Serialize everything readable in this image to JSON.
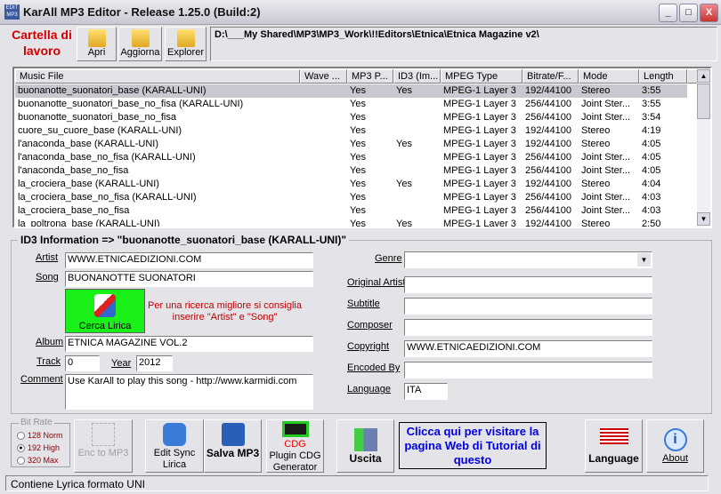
{
  "window": {
    "title": "KarAll MP3 Editor - Release 1.25.0 (Build:2)",
    "app_icon_text": "EDIT MP3"
  },
  "toolbar": {
    "folder_label": "Cartella di lavoro",
    "buttons": [
      {
        "label": "Apri",
        "icon": "folder-music-icon"
      },
      {
        "label": "Aggiorna",
        "icon": "folder-refresh-icon"
      },
      {
        "label": "Explorer",
        "icon": "folder-window-icon"
      }
    ],
    "path": "D:\\___My Shared\\MP3\\MP3_Work\\!!Editors\\Etnica\\Etnica Magazine v2\\"
  },
  "list": {
    "columns": [
      "Music File",
      "Wave ...",
      "MP3 P...",
      "ID3 (Im...",
      "MPEG Type",
      "Bitrate/F...",
      "Mode",
      "Length"
    ],
    "rows": [
      [
        "buonanotte_suonatori_base (KARALL-UNI)",
        "",
        "Yes",
        "Yes",
        "MPEG-1 Layer 3",
        "192/44100",
        "Stereo",
        "3:55"
      ],
      [
        "buonanotte_suonatori_base_no_fisa (KARALL-UNI)",
        "",
        "Yes",
        "",
        "MPEG-1 Layer 3",
        "256/44100",
        "Joint Ster...",
        "3:55"
      ],
      [
        "buonanotte_suonatori_base_no_fisa",
        "",
        "Yes",
        "",
        "MPEG-1 Layer 3",
        "256/44100",
        "Joint Ster...",
        "3:54"
      ],
      [
        "cuore_su_cuore_base (KARALL-UNI)",
        "",
        "Yes",
        "",
        "MPEG-1 Layer 3",
        "192/44100",
        "Stereo",
        "4:19"
      ],
      [
        "l'anaconda_base (KARALL-UNI)",
        "",
        "Yes",
        "Yes",
        "MPEG-1 Layer 3",
        "192/44100",
        "Stereo",
        "4:05"
      ],
      [
        "l'anaconda_base_no_fisa (KARALL-UNI)",
        "",
        "Yes",
        "",
        "MPEG-1 Layer 3",
        "256/44100",
        "Joint Ster...",
        "4:05"
      ],
      [
        "l'anaconda_base_no_fisa",
        "",
        "Yes",
        "",
        "MPEG-1 Layer 3",
        "256/44100",
        "Joint Ster...",
        "4:05"
      ],
      [
        "la_crociera_base (KARALL-UNI)",
        "",
        "Yes",
        "Yes",
        "MPEG-1 Layer 3",
        "192/44100",
        "Stereo",
        "4:04"
      ],
      [
        "la_crociera_base_no_fisa (KARALL-UNI)",
        "",
        "Yes",
        "",
        "MPEG-1 Layer 3",
        "256/44100",
        "Joint Ster...",
        "4:03"
      ],
      [
        "la_crociera_base_no_fisa",
        "",
        "Yes",
        "",
        "MPEG-1 Layer 3",
        "256/44100",
        "Joint Ster...",
        "4:03"
      ],
      [
        "la_poltrona_base (KARALL-UNI)",
        "",
        "Yes",
        "Yes",
        "MPEG-1 Layer 3",
        "192/44100",
        "Stereo",
        "2:50"
      ]
    ],
    "selected_row": 0
  },
  "id3": {
    "title": "ID3 Information => \"buonanotte_suonatori_base (KARALL-UNI)\"",
    "artist_label": "Artist",
    "artist": "WWW.ETNICAEDIZIONI.COM",
    "song_label": "Song",
    "song": "BUONANOTTE SUONATORI",
    "cerca_label": "Cerca Lirica",
    "hint": "Per una ricerca migliore si consiglia inserire \"Artist\" e \"Song\"",
    "album_label": "Album",
    "album": "ETNICA MAGAZINE VOL.2",
    "track_label": "Track",
    "track": "0",
    "year_label": "Year",
    "year": "2012",
    "comment_label": "Comment",
    "comment": "Use KarAll to play this song - http://www.karmidi.com",
    "genre_label": "Genre",
    "genre": "",
    "original_artist_label": "Original Artist",
    "original_artist": "",
    "subtitle_label": "Subtitle",
    "subtitle": "",
    "composer_label": "Composer",
    "composer": "",
    "copyright_label": "Copyright",
    "copyright": "WWW.ETNICAEDIZIONI.COM",
    "encoded_by_label": "Encoded By",
    "encoded_by": "",
    "language_label": "Language",
    "language": "ITA"
  },
  "bottom": {
    "bitrate_label": "Bit Rate",
    "bitrates": [
      "128 Norm",
      "192 High",
      "320 Max"
    ],
    "bitrate_selected": "192 High",
    "enc_label": "Enc to MP3",
    "edit_sync_label": "Edit Sync Lirica",
    "salva_label": "Salva MP3",
    "cdg_icon_text": "CDG",
    "cdg_label": "Plugin CDG Generator",
    "uscita_label": "Uscita",
    "web_link": "Clicca qui per visitare la pagina Web di Tutorial  di questo",
    "language_label": "Language",
    "about_label": "About"
  },
  "status": "Contiene Lyrica formato UNI"
}
